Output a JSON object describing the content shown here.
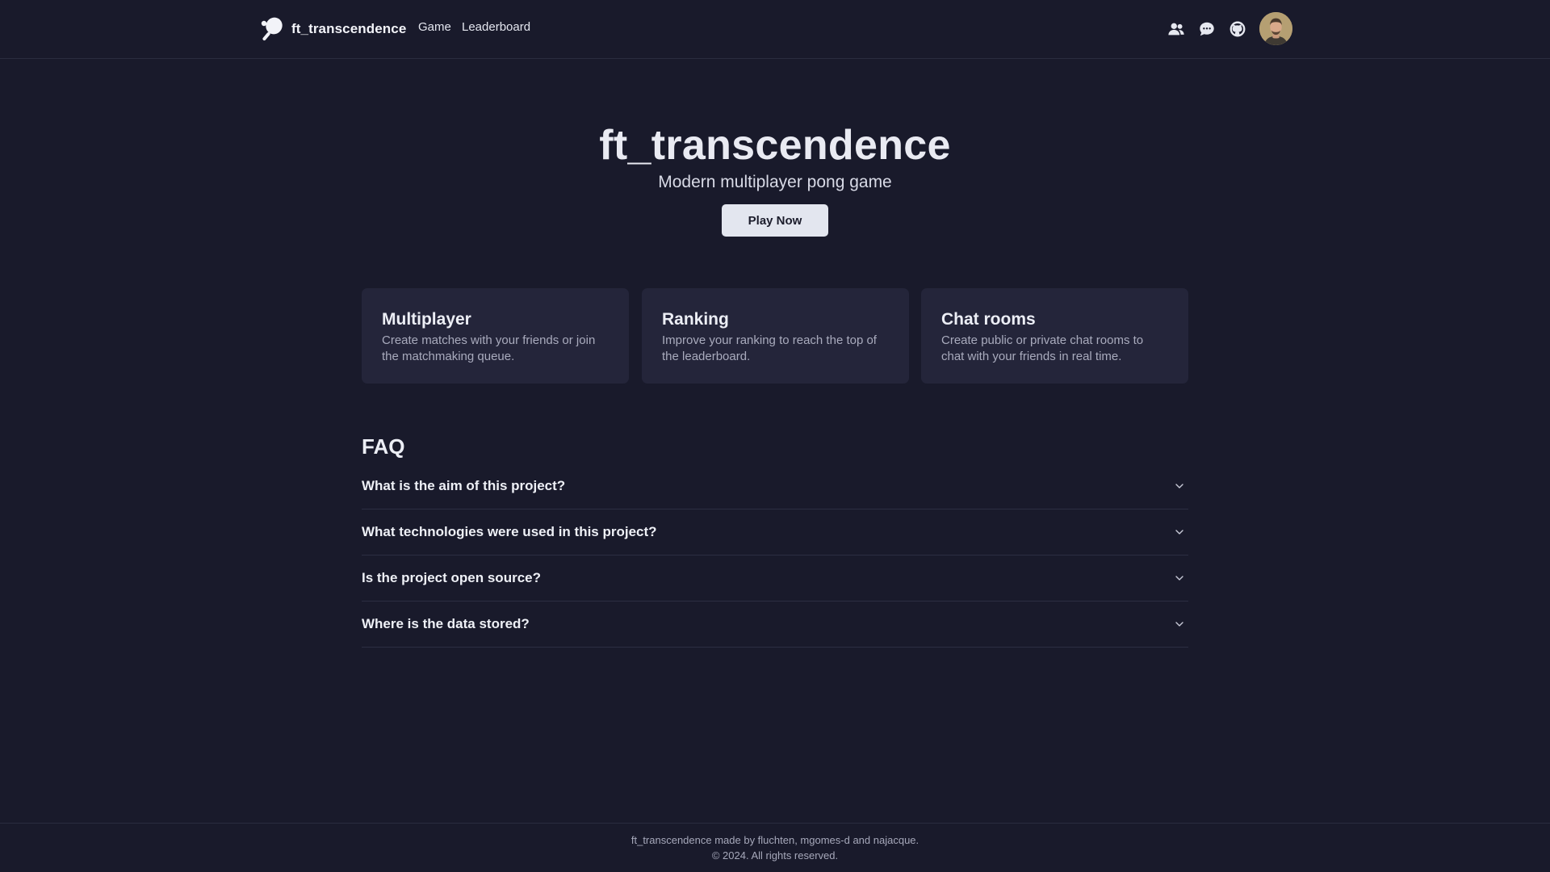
{
  "header": {
    "brand": "ft_transcendence",
    "logo_icon": "ping-pong-paddle-icon",
    "nav": [
      {
        "label": "Game"
      },
      {
        "label": "Leaderboard"
      }
    ],
    "icons": [
      "friends-icon",
      "chat-bubble-icon",
      "github-icon"
    ],
    "avatar": "user-avatar"
  },
  "hero": {
    "title": "ft_transcendence",
    "subtitle": "Modern multiplayer pong game",
    "cta_label": "Play Now"
  },
  "features": [
    {
      "title": "Multiplayer",
      "description": "Create matches with your friends or join the matchmaking queue."
    },
    {
      "title": "Ranking",
      "description": "Improve your ranking to reach the top of the leaderboard."
    },
    {
      "title": "Chat rooms",
      "description": "Create public or private chat rooms to chat with your friends in real time."
    }
  ],
  "faq": {
    "heading": "FAQ",
    "items": [
      {
        "question": "What is the aim of this project?"
      },
      {
        "question": "What technologies were used in this project?"
      },
      {
        "question": "Is the project open source?"
      },
      {
        "question": "Where is the data stored?"
      }
    ]
  },
  "footer": {
    "line1": "ft_transcendence made by fluchten, mgomes-d and najacque.",
    "line2": "© 2024. All rights reserved."
  },
  "colors": {
    "background": "#191a2b",
    "card": "#24253a",
    "button": "#e3e6ef",
    "text": "#e6e8f0",
    "muted": "#a9abbd"
  }
}
